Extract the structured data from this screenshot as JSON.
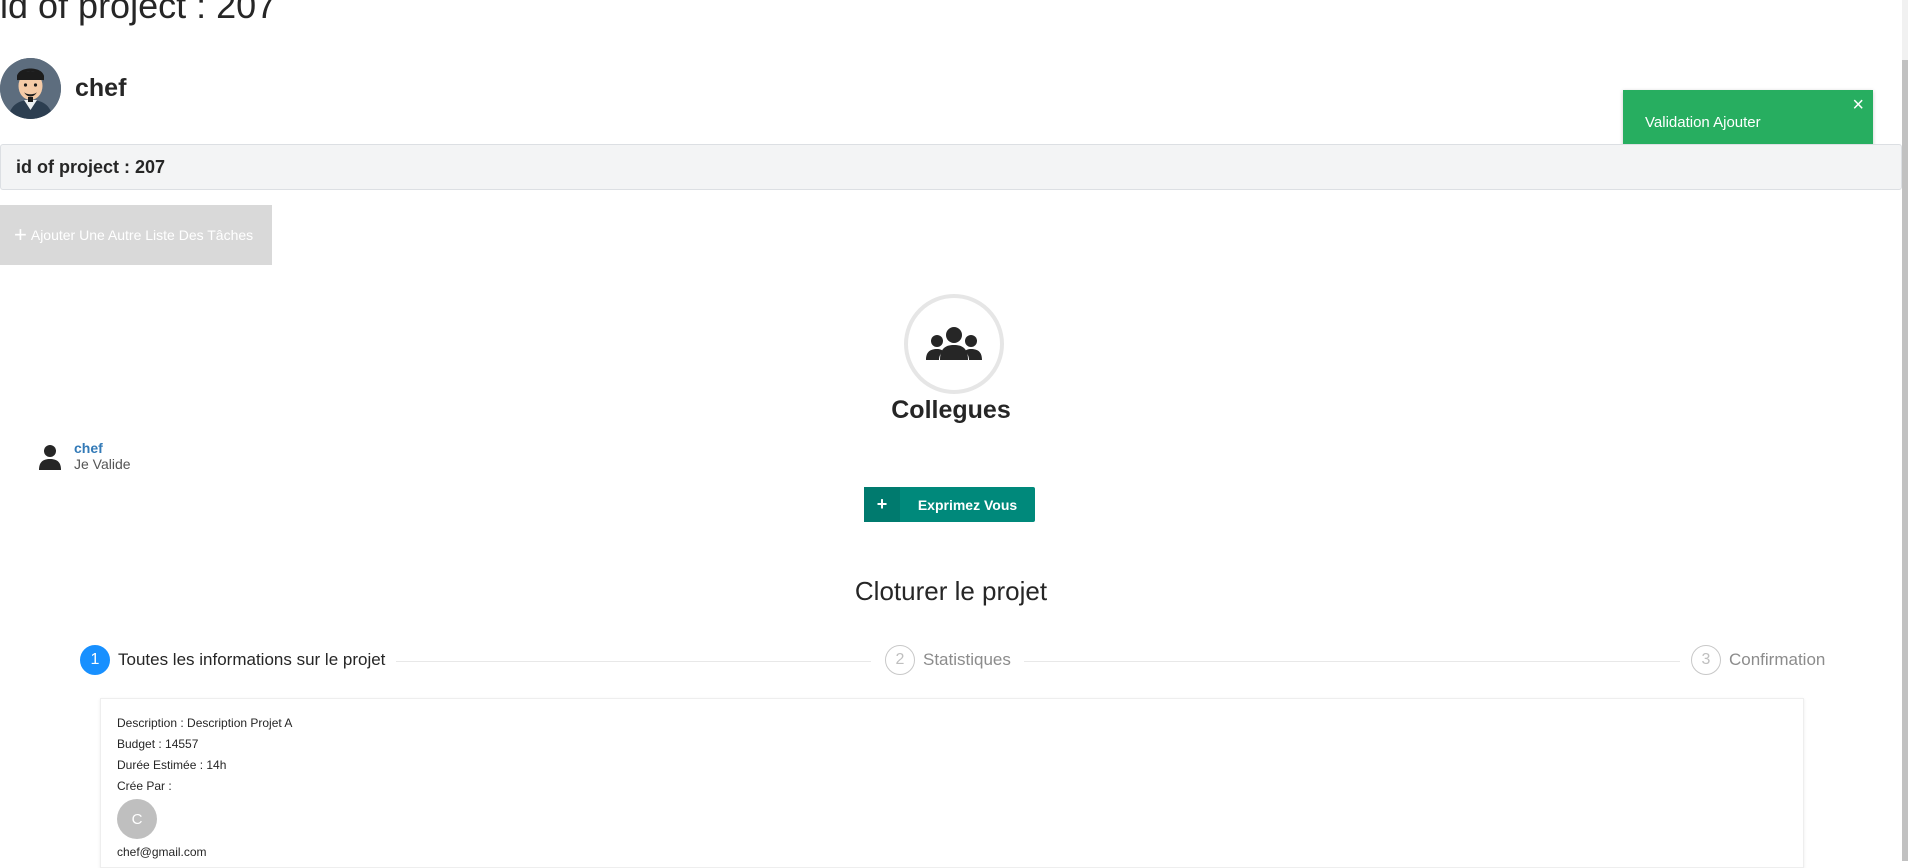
{
  "page": {
    "heading": "id of project : 207"
  },
  "header": {
    "user_name": "chef"
  },
  "project_bar": {
    "text": "id of project : 207"
  },
  "actions": {
    "add_list_label": "Ajouter Une Autre Liste Des Tâches"
  },
  "toast": {
    "message": "Validation Ajouter",
    "close": "×",
    "color": "#27ae60"
  },
  "team": {
    "title": "Collegues",
    "icon": "users-icon",
    "members": [
      {
        "name": "chef",
        "status": "Je Valide"
      }
    ]
  },
  "express_button": {
    "label": "Exprimez Vous",
    "icon": "plus-icon",
    "color": "#00897b"
  },
  "closing": {
    "title": "Cloturer le projet",
    "steps": [
      {
        "number": "1",
        "label": "Toutes les informations sur le projet",
        "active": true
      },
      {
        "number": "2",
        "label": "Statistiques",
        "active": false
      },
      {
        "number": "3",
        "label": "Confirmation",
        "active": false
      }
    ],
    "active_color": "#1890ff"
  },
  "project_info": {
    "description": "Description : Description Projet A",
    "budget": "Budget : 14557",
    "duration": "Durée Estimée : 14h",
    "created_by_label": "Crée Par :",
    "creator_initial": "C",
    "creator_email": "chef@gmail.com"
  }
}
